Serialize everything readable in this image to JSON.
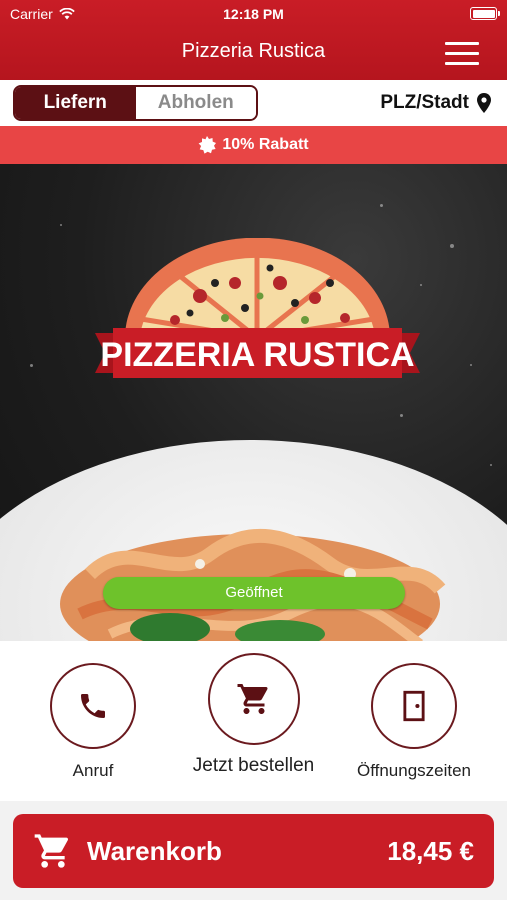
{
  "status_bar": {
    "carrier": "Carrier",
    "time": "12:18 PM"
  },
  "header": {
    "title": "Pizzeria Rustica"
  },
  "mode": {
    "deliver": "Liefern",
    "pickup": "Abholen",
    "location": "PLZ/Stadt"
  },
  "banner": {
    "discount": "10% Rabatt"
  },
  "hero": {
    "logo_text": "PIZZERIA RUSTICA",
    "status": "Geöffnet"
  },
  "actions": [
    {
      "label": "Anruf",
      "icon": "phone-icon"
    },
    {
      "label": "Jetzt bestellen",
      "icon": "cart-icon"
    },
    {
      "label": "Öffnungszeiten",
      "icon": "door-icon"
    }
  ],
  "cart": {
    "label": "Warenkorb",
    "total": "18,45 €"
  },
  "colors": {
    "brand": "#c91d26",
    "dark": "#5c1014",
    "open": "#6ec22b",
    "banner": "#e84545"
  }
}
